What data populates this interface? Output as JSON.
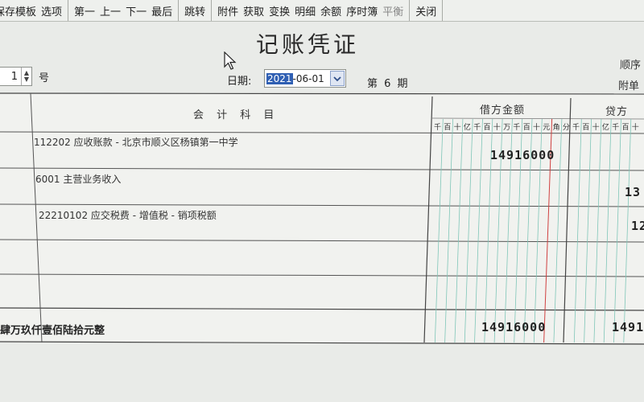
{
  "toolbar": {
    "groups": [
      [
        "保存模板",
        "选项"
      ],
      [
        "第一",
        "上一",
        "下一",
        "最后"
      ],
      [
        "跳转"
      ],
      [
        "附件",
        "获取",
        "变换",
        "明细",
        "余额",
        "序时簿",
        "平衡"
      ],
      [
        "关闭"
      ]
    ],
    "disabled": [
      "平衡"
    ]
  },
  "voucher": {
    "title": "记账凭证",
    "number_value": "1",
    "number_suffix": "号",
    "date_label": "日期:",
    "date_year": "2021",
    "date_rest": "-06-01",
    "period": "第 6 期",
    "order_label": "顺序",
    "attach_label": "附单",
    "subject_header": "会 计 科 目",
    "debit_header": "借方金额",
    "credit_header": "贷方",
    "digit_units": [
      "千",
      "百",
      "十",
      "亿",
      "千",
      "百",
      "十",
      "万",
      "千",
      "百",
      "十",
      "元",
      "角",
      "分"
    ],
    "credit_digit_units": [
      "千",
      "百",
      "十",
      "亿",
      "千",
      "百",
      "十"
    ],
    "rows": [
      {
        "subject": "112202 应收账款 - 北京市顺义区杨镇第一中学",
        "debit": "14916000",
        "credit": ""
      },
      {
        "subject": "6001 主营业务收入",
        "debit": "",
        "credit": "13"
      },
      {
        "subject": "22210102 应交税费 - 增值税 - 销项税额",
        "debit": "",
        "credit": "12"
      }
    ],
    "total_text": "肆万玖仟壹佰陆拾元整",
    "total_debit": "14916000",
    "total_credit": "1491"
  },
  "colors": {
    "grid_line": "#555555",
    "digit_line": "#7fc6b8",
    "yuan_line": "#d04040",
    "selection": "#2f5fb3"
  }
}
